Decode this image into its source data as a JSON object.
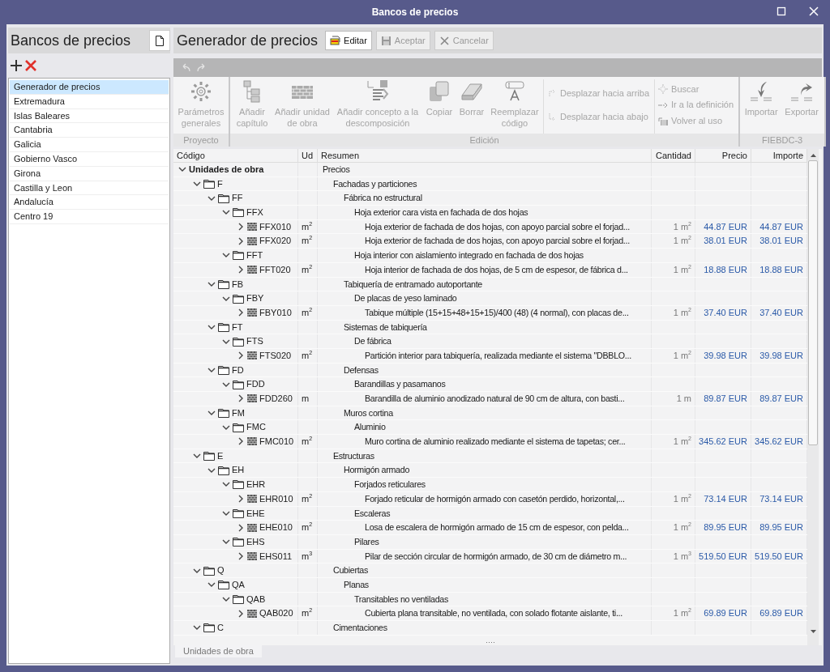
{
  "window": {
    "title": "Bancos de precios"
  },
  "sidebar": {
    "title": "Bancos de precios",
    "items": [
      {
        "label": "Generador de precios",
        "selected": true
      },
      {
        "label": "Extremadura",
        "selected": false
      },
      {
        "label": "Islas Baleares",
        "selected": false
      },
      {
        "label": "Cantabria",
        "selected": false
      },
      {
        "label": "Galicia",
        "selected": false
      },
      {
        "label": "Gobierno Vasco",
        "selected": false
      },
      {
        "label": "Girona",
        "selected": false
      },
      {
        "label": "Castilla y Leon",
        "selected": false
      },
      {
        "label": "Andalucía",
        "selected": false
      },
      {
        "label": "Centro 19",
        "selected": false
      }
    ]
  },
  "main": {
    "title": "Generador de precios",
    "buttons": [
      {
        "label": "Editar",
        "disabled": false
      },
      {
        "label": "Aceptar",
        "disabled": true
      },
      {
        "label": "Cancelar",
        "disabled": true
      }
    ]
  },
  "ribbon": {
    "groups": [
      {
        "label": "Proyecto",
        "sections": [
          [
            {
              "kind": "large",
              "label": "Parámetros generales",
              "disabled": true
            }
          ]
        ]
      },
      {
        "label": "Edición",
        "sections": [
          [
            {
              "kind": "large",
              "label": "Añadir capítulo",
              "disabled": true
            },
            {
              "kind": "large",
              "label": "Añadir unidad de obra",
              "disabled": true
            },
            {
              "kind": "large",
              "label": "Añadir concepto a la descomposición",
              "disabled": true
            },
            {
              "kind": "large",
              "label": "Copiar",
              "disabled": true
            },
            {
              "kind": "large",
              "label": "Borrar",
              "disabled": true
            },
            {
              "kind": "large",
              "label": "Reemplazar código",
              "disabled": true
            }
          ],
          [
            {
              "kind": "small",
              "label": "Desplazar hacia arriba",
              "disabled": true
            },
            {
              "kind": "small",
              "label": "Desplazar hacia abajo",
              "disabled": true
            }
          ],
          [
            {
              "kind": "small",
              "label": "Buscar",
              "disabled": true
            },
            {
              "kind": "small",
              "label": "Ir a la definición",
              "disabled": true
            },
            {
              "kind": "small",
              "label": "Volver al uso",
              "disabled": true
            }
          ]
        ]
      },
      {
        "label": "FIEBDC-3",
        "sections": [
          [
            {
              "kind": "large",
              "label": "Importar",
              "disabled": true
            },
            {
              "kind": "large",
              "label": "Exportar",
              "disabled": true
            }
          ]
        ]
      }
    ]
  },
  "table": {
    "columns": [
      "Código",
      "Ud",
      "Resumen",
      "Cantidad",
      "Precio",
      "Importe"
    ],
    "rows": [
      {
        "kind": "root",
        "code": "Unidades de obra",
        "summary": "Precios",
        "expanded": true,
        "children": [
          {
            "kind": "chapter",
            "code": "F",
            "summary": "Fachadas y particiones",
            "expanded": true,
            "children": [
              {
                "kind": "chapter",
                "code": "FF",
                "summary": "Fábrica no estructural",
                "expanded": true,
                "children": [
                  {
                    "kind": "chapter",
                    "code": "FFX",
                    "summary": "Hoja exterior cara vista en fachada de dos hojas",
                    "expanded": true,
                    "children": [
                      {
                        "kind": "unit",
                        "code": "FFX010",
                        "unit": "m$^{2}$",
                        "summary": "Hoja exterior de fachada de dos hojas, con apoyo parcial sobre el forjad...",
                        "quantity": "1 m$^{2}$",
                        "price": "44.87 EUR",
                        "amount": "44.87 EUR",
                        "expanded": false
                      },
                      {
                        "kind": "unit",
                        "code": "FFX020",
                        "unit": "m$^{2}$",
                        "summary": "Hoja exterior de fachada de dos hojas, con apoyo parcial sobre el forjad...",
                        "quantity": "1 m$^{2}$",
                        "price": "38.01 EUR",
                        "amount": "38.01 EUR",
                        "expanded": false
                      }
                    ]
                  },
                  {
                    "kind": "chapter",
                    "code": "FFT",
                    "summary": "Hoja interior con aislamiento integrado en fachada de dos hojas",
                    "expanded": true,
                    "children": [
                      {
                        "kind": "unit",
                        "code": "FFT020",
                        "unit": "m$^{2}$",
                        "summary": "Hoja interior de fachada de dos hojas, de 5 cm de espesor, de fábrica d...",
                        "quantity": "1 m$^{2}$",
                        "price": "18.88 EUR",
                        "amount": "18.88 EUR",
                        "expanded": false
                      }
                    ]
                  }
                ]
              },
              {
                "kind": "chapter",
                "code": "FB",
                "summary": "Tabiquería de entramado autoportante",
                "expanded": true,
                "children": [
                  {
                    "kind": "chapter",
                    "code": "FBY",
                    "summary": "De placas de yeso laminado",
                    "expanded": true,
                    "children": [
                      {
                        "kind": "unit",
                        "code": "FBY010",
                        "unit": "m$^{2}$",
                        "summary": "Tabique múltiple (15+15+48+15+15)/400 (48) (4 normal), con placas de...",
                        "quantity": "1 m$^{2}$",
                        "price": "37.40 EUR",
                        "amount": "37.40 EUR",
                        "expanded": false
                      }
                    ]
                  }
                ]
              },
              {
                "kind": "chapter",
                "code": "FT",
                "summary": "Sistemas de tabiquería",
                "expanded": true,
                "children": [
                  {
                    "kind": "chapter",
                    "code": "FTS",
                    "summary": "De fábrica",
                    "expanded": true,
                    "children": [
                      {
                        "kind": "unit",
                        "code": "FTS020",
                        "unit": "m$^{2}$",
                        "summary": "Partición interior para tabiquería, realizada mediante el sistema \"DBBLO...",
                        "quantity": "1 m$^{2}$",
                        "price": "39.98 EUR",
                        "amount": "39.98 EUR",
                        "expanded": false
                      }
                    ]
                  }
                ]
              },
              {
                "kind": "chapter",
                "code": "FD",
                "summary": "Defensas",
                "expanded": true,
                "children": [
                  {
                    "kind": "chapter",
                    "code": "FDD",
                    "summary": "Barandillas y pasamanos",
                    "expanded": true,
                    "children": [
                      {
                        "kind": "unit",
                        "code": "FDD260",
                        "unit": "m",
                        "summary": "Barandilla de aluminio anodizado natural de 90 cm de altura, con basti...",
                        "quantity": "1 m",
                        "price": "89.87 EUR",
                        "amount": "89.87 EUR",
                        "expanded": false
                      }
                    ]
                  }
                ]
              },
              {
                "kind": "chapter",
                "code": "FM",
                "summary": "Muros cortina",
                "expanded": true,
                "children": [
                  {
                    "kind": "chapter",
                    "code": "FMC",
                    "summary": "Aluminio",
                    "expanded": true,
                    "children": [
                      {
                        "kind": "unit",
                        "code": "FMC010",
                        "unit": "m$^{2}$",
                        "summary": "Muro cortina de aluminio realizado mediante el sistema de tapetas; cer...",
                        "quantity": "1 m$^{2}$",
                        "price": "345.62 EUR",
                        "amount": "345.62 EUR",
                        "expanded": false
                      }
                    ]
                  }
                ]
              }
            ]
          },
          {
            "kind": "chapter",
            "code": "E",
            "summary": "Estructuras",
            "expanded": true,
            "children": [
              {
                "kind": "chapter",
                "code": "EH",
                "summary": "Hormigón armado",
                "expanded": true,
                "children": [
                  {
                    "kind": "chapter",
                    "code": "EHR",
                    "summary": "Forjados reticulares",
                    "expanded": true,
                    "children": [
                      {
                        "kind": "unit",
                        "code": "EHR010",
                        "unit": "m$^{2}$",
                        "summary": "Forjado reticular de hormigón armado con casetón perdido, horizontal,...",
                        "quantity": "1 m$^{2}$",
                        "price": "73.14 EUR",
                        "amount": "73.14 EUR",
                        "expanded": false
                      }
                    ]
                  },
                  {
                    "kind": "chapter",
                    "code": "EHE",
                    "summary": "Escaleras",
                    "expanded": true,
                    "children": [
                      {
                        "kind": "unit",
                        "code": "EHE010",
                        "unit": "m$^{2}$",
                        "summary": "Losa de escalera de hormigón armado de 15 cm de espesor, con pelda...",
                        "quantity": "1 m$^{2}$",
                        "price": "89.95 EUR",
                        "amount": "89.95 EUR",
                        "expanded": false
                      }
                    ]
                  },
                  {
                    "kind": "chapter",
                    "code": "EHS",
                    "summary": "Pilares",
                    "expanded": true,
                    "children": [
                      {
                        "kind": "unit",
                        "code": "EHS011",
                        "unit": "m$^{3}$",
                        "summary": "Pilar de sección circular de hormigón armado, de 30 cm de diámetro m...",
                        "quantity": "1 m$^{3}$",
                        "price": "519.50 EUR",
                        "amount": "519.50 EUR",
                        "expanded": false
                      }
                    ]
                  }
                ]
              }
            ]
          },
          {
            "kind": "chapter",
            "code": "Q",
            "summary": "Cubiertas",
            "expanded": true,
            "children": [
              {
                "kind": "chapter",
                "code": "QA",
                "summary": "Planas",
                "expanded": true,
                "children": [
                  {
                    "kind": "chapter",
                    "code": "QAB",
                    "summary": "Transitables no ventiladas",
                    "expanded": true,
                    "children": [
                      {
                        "kind": "unit",
                        "code": "QAB020",
                        "unit": "m$^{2}$",
                        "summary": "Cubierta plana transitable, no ventilada, con solado flotante aislante, ti...",
                        "quantity": "1 m$^{2}$",
                        "price": "69.89 EUR",
                        "amount": "69.89 EUR",
                        "expanded": false
                      }
                    ]
                  }
                ]
              }
            ]
          },
          {
            "kind": "chapter",
            "code": "C",
            "summary": "Cimentaciones",
            "expanded": true
          }
        ]
      }
    ]
  },
  "tabs": [
    {
      "label": "Unidades de obra",
      "selected": true
    }
  ]
}
